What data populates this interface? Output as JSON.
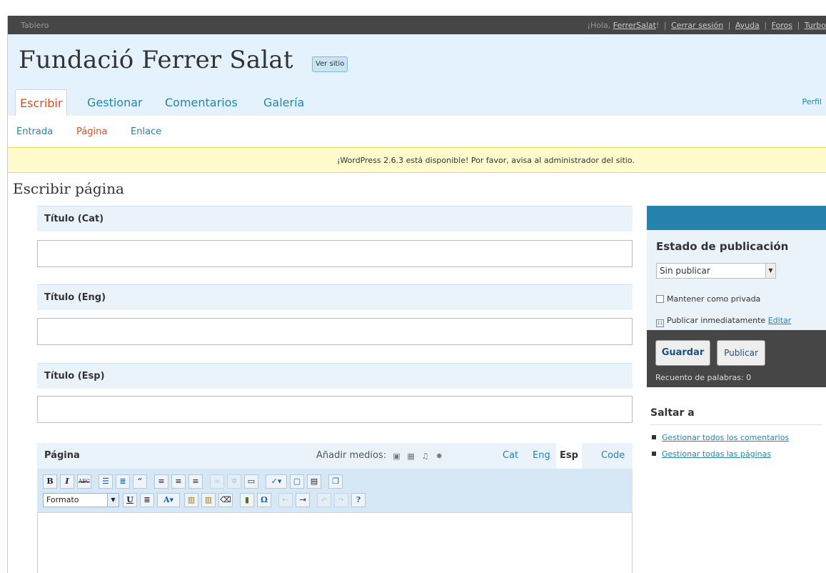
{
  "topbar": {
    "dashboard": "Tablero",
    "greeting": "¡Hola, ",
    "user": "FerrerSalat",
    "greeting_end": "!",
    "logout": "Cerrar sesión",
    "help": "Ayuda",
    "forums": "Foros",
    "turbo": "Turbo",
    "separator": "|"
  },
  "header": {
    "site_title": "Fundació Ferrer Salat",
    "visit_site": "Ver sitio",
    "tabs": [
      "Escribir",
      "Gestionar",
      "Comentarios",
      "Galería"
    ],
    "profile": "Perfil"
  },
  "submenu": [
    "Entrada",
    "Página",
    "Enlace"
  ],
  "notice": "¡WordPress 2.6.3 está disponible! Por favor, avisa al administrador del sitio.",
  "page_title": "Escribir página",
  "fields": [
    {
      "label": "Título (Cat)",
      "value": ""
    },
    {
      "label": "Título (Eng)",
      "value": ""
    },
    {
      "label": "Título (Esp)",
      "value": ""
    }
  ],
  "editor": {
    "label": "Página",
    "add_media": "Añadir medios:",
    "languages": [
      "Cat",
      "Eng",
      "Esp",
      "Code"
    ],
    "active_language": "Esp",
    "format_select": "Formato",
    "content": ""
  },
  "sidebar": {
    "status_title": "Estado de publicación",
    "status_value": "Sin publicar",
    "keep_private": "Mantener como privada",
    "publish_now": "Publicar inmediatamente",
    "edit": "Editar",
    "save": "Guardar",
    "publish": "Publicar",
    "word_count": "Recuento de palabras: 0",
    "jump_title": "Saltar a",
    "jump_links": [
      "Gestionar todos los comentarios",
      "Gestionar todas las páginas"
    ]
  }
}
